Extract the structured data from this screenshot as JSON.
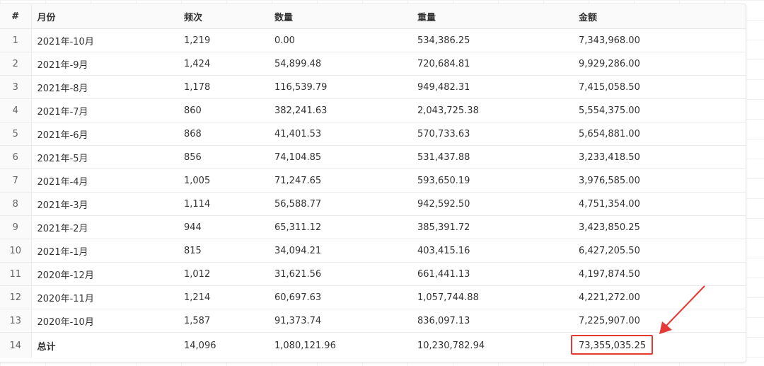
{
  "table": {
    "headers": {
      "index": "#",
      "month": "月份",
      "frequency": "频次",
      "quantity": "数量",
      "weight": "重量",
      "amount": "金额"
    },
    "rows": [
      {
        "index": "1",
        "month": "2021年-10月",
        "frequency": "1,219",
        "quantity": "0.00",
        "weight": "534,386.25",
        "amount": "7,343,968.00"
      },
      {
        "index": "2",
        "month": "2021年-9月",
        "frequency": "1,424",
        "quantity": "54,899.48",
        "weight": "720,684.81",
        "amount": "9,929,286.00"
      },
      {
        "index": "3",
        "month": "2021年-8月",
        "frequency": "1,178",
        "quantity": "116,539.79",
        "weight": "949,482.31",
        "amount": "7,415,058.50"
      },
      {
        "index": "4",
        "month": "2021年-7月",
        "frequency": "860",
        "quantity": "382,241.63",
        "weight": "2,043,725.38",
        "amount": "5,554,375.00"
      },
      {
        "index": "5",
        "month": "2021年-6月",
        "frequency": "868",
        "quantity": "41,401.53",
        "weight": "570,733.63",
        "amount": "5,654,881.00"
      },
      {
        "index": "6",
        "month": "2021年-5月",
        "frequency": "856",
        "quantity": "74,104.85",
        "weight": "531,437.88",
        "amount": "3,233,418.50"
      },
      {
        "index": "7",
        "month": "2021年-4月",
        "frequency": "1,005",
        "quantity": "71,247.65",
        "weight": "593,650.19",
        "amount": "3,976,585.00"
      },
      {
        "index": "8",
        "month": "2021年-3月",
        "frequency": "1,114",
        "quantity": "56,588.77",
        "weight": "942,592.50",
        "amount": "4,751,354.00"
      },
      {
        "index": "9",
        "month": "2021年-2月",
        "frequency": "944",
        "quantity": "65,311.12",
        "weight": "385,391.72",
        "amount": "3,423,850.25"
      },
      {
        "index": "10",
        "month": "2021年-1月",
        "frequency": "815",
        "quantity": "34,094.21",
        "weight": "403,415.16",
        "amount": "6,427,205.50"
      },
      {
        "index": "11",
        "month": "2020年-12月",
        "frequency": "1,012",
        "quantity": "31,621.56",
        "weight": "661,441.13",
        "amount": "4,197,874.50"
      },
      {
        "index": "12",
        "month": "2020年-11月",
        "frequency": "1,214",
        "quantity": "60,697.63",
        "weight": "1,057,744.88",
        "amount": "4,221,272.00"
      },
      {
        "index": "13",
        "month": "2020年-10月",
        "frequency": "1,587",
        "quantity": "91,373.74",
        "weight": "836,097.13",
        "amount": "7,225,907.00"
      }
    ],
    "total": {
      "index": "14",
      "month": "总计",
      "frequency": "14,096",
      "quantity": "1,080,121.96",
      "weight": "10,230,782.94",
      "amount": "73,355,035.25"
    }
  },
  "annotation": {
    "highlight_color": "#e53935",
    "target": "total-amount-cell"
  }
}
